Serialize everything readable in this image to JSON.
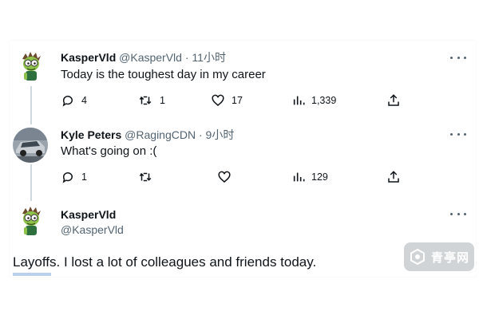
{
  "tweets": [
    {
      "name": "KasperVld",
      "handle": "@KasperVld",
      "dot": "·",
      "time": "11小时",
      "text": "Today is the toughest day in my career",
      "avatar_icon": "cartoon-character-avatar",
      "actions": {
        "replies": "4",
        "retweets": "1",
        "likes": "17",
        "views": "1,339"
      }
    },
    {
      "name": "Kyle Peters",
      "handle": "@RagingCDN",
      "dot": "·",
      "time": "9小时",
      "text": "What's going  on :(",
      "avatar_icon": "car-photo-avatar",
      "actions": {
        "replies": "1",
        "retweets": "",
        "likes": "",
        "views": "129"
      }
    },
    {
      "name": "KasperVld",
      "handle": "@KasperVld",
      "text": "Layoffs. I lost a lot of colleagues and friends today.",
      "avatar_icon": "cartoon-character-avatar"
    }
  ],
  "icons": [
    "reply-icon",
    "retweet-icon",
    "like-icon",
    "views-icon",
    "share-icon",
    "more-icon"
  ],
  "colors": {
    "text": "#0f1419",
    "secondary": "#536471",
    "thread_line": "#cfd9de"
  },
  "watermark": {
    "text": "青亭网"
  }
}
